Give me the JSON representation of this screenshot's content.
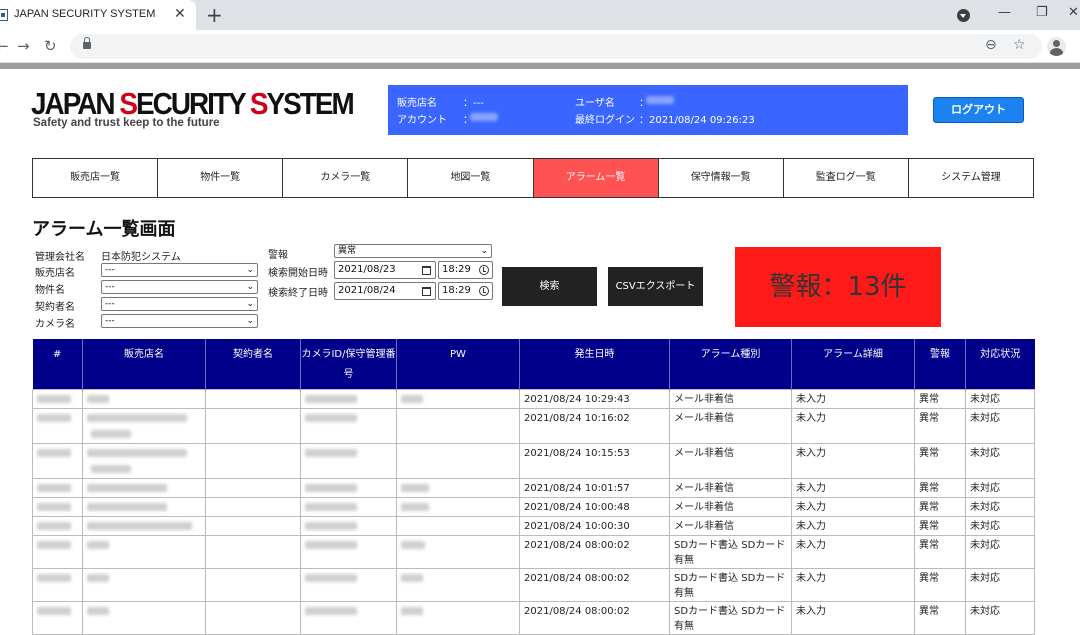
{
  "browser": {
    "tab_title": "JAPAN SECURITY SYSTEM",
    "tab_close": "✕",
    "new_tab": "+",
    "minimize": "—",
    "restore": "❐",
    "close": "✕",
    "back": "←",
    "forward": "→",
    "reload": "↻",
    "zoom_icon": "⊖",
    "star_icon": "☆"
  },
  "header": {
    "logo_part1": "JAPAN ",
    "logo_s": "S",
    "logo_part2": "ECURITY ",
    "logo_s2": "S",
    "logo_part3": "YSTEM",
    "tagline": "Safety and trust keep to the future",
    "info": {
      "dealer_label": "販売店名",
      "dealer_value": "：---",
      "account_label": "アカウント",
      "account_sep": "：",
      "user_label": "ユーザ名",
      "user_sep": "：",
      "last_login_label": "最終ログイン",
      "last_login_value": "：2021/08/24 09:26:23"
    },
    "logout_label": "ログアウト"
  },
  "nav": [
    {
      "label": "販売店一覧",
      "active": false
    },
    {
      "label": "物件一覧",
      "active": false
    },
    {
      "label": "カメラ一覧",
      "active": false
    },
    {
      "label": "地図一覧",
      "active": false
    },
    {
      "label": "アラーム一覧",
      "active": true
    },
    {
      "label": "保守情報一覧",
      "active": false
    },
    {
      "label": "監査ログ一覧",
      "active": false
    },
    {
      "label": "システム管理",
      "active": false
    }
  ],
  "colors": {
    "nav_active": "#ff5252",
    "alarm_box": "#ff1a1a",
    "table_header": "#00008b",
    "info_box": "#3a66ff",
    "logout": "#1b82f0"
  },
  "page_title": "アラーム一覧画面",
  "filters": {
    "company_label": "管理会社名",
    "company_value": "日本防犯システム",
    "dealer_label": "販売店名",
    "dealer_value": "---",
    "property_label": "物件名",
    "property_value": "---",
    "contractor_label": "契約者名",
    "contractor_value": "---",
    "camera_label": "カメラ名",
    "camera_value": "---",
    "alarm_label": "警報",
    "alarm_value": "異常",
    "start_label": "検索開始日時",
    "start_date": "2021/08/23",
    "start_time": "18:29",
    "end_label": "検索終了日時",
    "end_date": "2021/08/24",
    "end_time": "18:29"
  },
  "search_button": "検索",
  "csv_button": "CSVエクスポート",
  "alarm_count": "警報：13件",
  "table": {
    "headers": [
      "#",
      "販売店名",
      "契約者名",
      "カメラID/保守管理番号",
      "PW",
      "発生日時",
      "アラーム種別",
      "アラーム詳細",
      "警報",
      "対応状況"
    ],
    "rows": [
      {
        "datetime": "2021/08/24 10:29:43",
        "type": "メール非着信",
        "detail": "未入力",
        "alarm": "異常",
        "status": "未対応"
      },
      {
        "datetime": "2021/08/24 10:16:02",
        "type": "メール非着信",
        "detail": "未入力",
        "alarm": "異常",
        "status": "未対応"
      },
      {
        "datetime": "2021/08/24 10:15:53",
        "type": "メール非着信",
        "detail": "未入力",
        "alarm": "異常",
        "status": "未対応"
      },
      {
        "datetime": "2021/08/24 10:01:57",
        "type": "メール非着信",
        "detail": "未入力",
        "alarm": "異常",
        "status": "未対応"
      },
      {
        "datetime": "2021/08/24 10:00:48",
        "type": "メール非着信",
        "detail": "未入力",
        "alarm": "異常",
        "status": "未対応"
      },
      {
        "datetime": "2021/08/24 10:00:30",
        "type": "メール非着信",
        "detail": "未入力",
        "alarm": "異常",
        "status": "未対応"
      },
      {
        "datetime": "2021/08/24 08:00:02",
        "type": "SDカード書込 SDカード有無",
        "detail": "未入力",
        "alarm": "異常",
        "status": "未対応"
      },
      {
        "datetime": "2021/08/24 08:00:02",
        "type": "SDカード書込 SDカード有無",
        "detail": "未入力",
        "alarm": "異常",
        "status": "未対応"
      },
      {
        "datetime": "2021/08/24 08:00:02",
        "type": "SDカード書込 SDカード有無",
        "detail": "未入力",
        "alarm": "異常",
        "status": "未対応"
      }
    ]
  }
}
